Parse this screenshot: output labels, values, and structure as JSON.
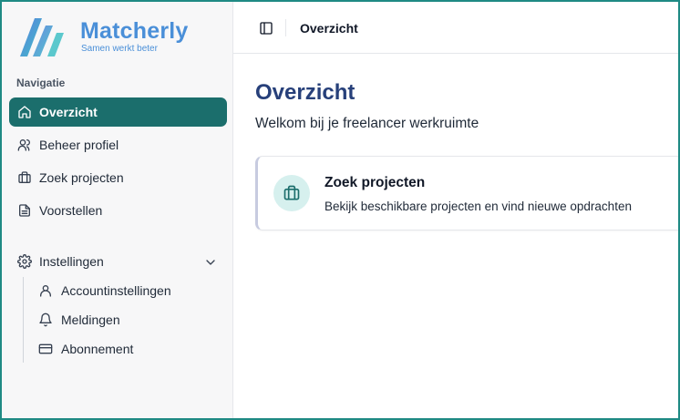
{
  "brand": {
    "name": "Matcherly",
    "tagline": "Samen werkt beter",
    "colors": {
      "primary": "#4a8fd8",
      "accent": "#1b6e6c",
      "heading": "#27407a"
    }
  },
  "sidebar": {
    "heading": "Navigatie",
    "items": [
      {
        "label": "Overzicht",
        "icon": "home-icon",
        "active": true
      },
      {
        "label": "Beheer profiel",
        "icon": "users-icon"
      },
      {
        "label": "Zoek projecten",
        "icon": "briefcase-icon"
      },
      {
        "label": "Voorstellen",
        "icon": "document-icon"
      }
    ],
    "settings": {
      "label": "Instellingen",
      "icon": "gear-icon",
      "expanded": true,
      "children": [
        {
          "label": "Accountinstellingen",
          "icon": "user-icon"
        },
        {
          "label": "Meldingen",
          "icon": "bell-icon"
        },
        {
          "label": "Abonnement",
          "icon": "credit-card-icon"
        }
      ]
    }
  },
  "topbar": {
    "breadcrumb": "Overzicht",
    "toggle_icon": "sidebar-toggle-icon"
  },
  "main": {
    "title": "Overzicht",
    "subtitle": "Welkom bij je freelancer werkruimte",
    "cards": [
      {
        "title": "Zoek projecten",
        "description": "Bekijk beschikbare projecten en vind nieuwe opdrachten",
        "icon": "briefcase-icon"
      }
    ]
  }
}
